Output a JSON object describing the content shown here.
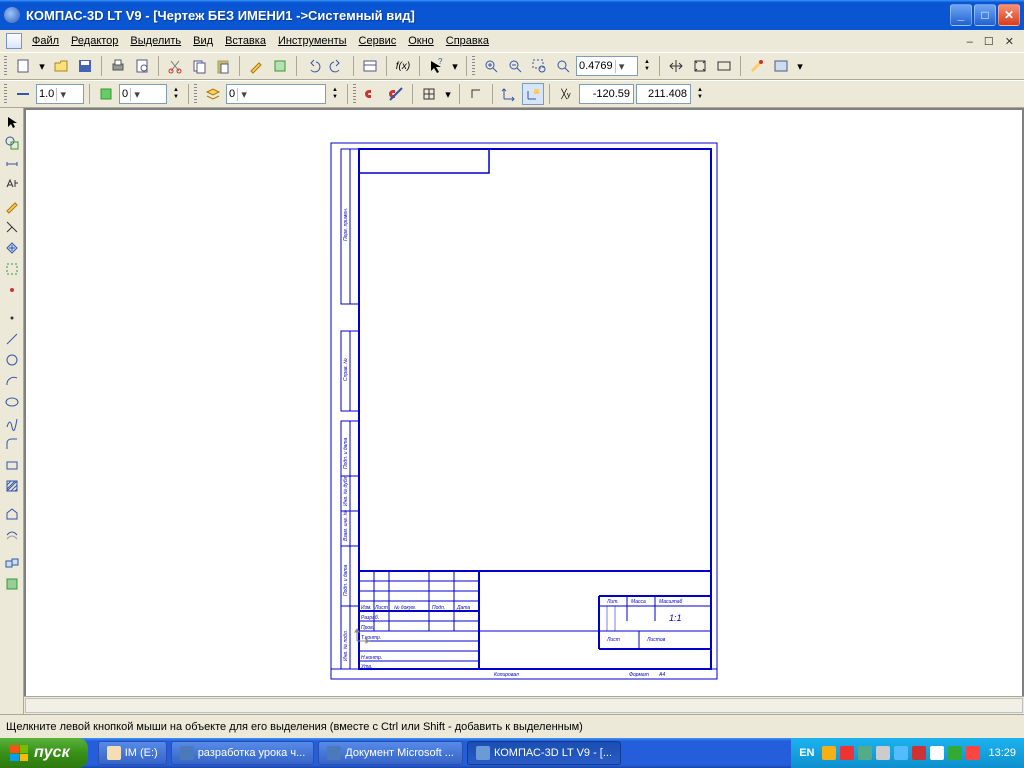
{
  "title": "КОМПАС-3D LT V9 - [Чертеж БЕЗ ИМЕНИ1 ->Системный вид]",
  "menu": {
    "file": "Файл",
    "edit": "Редактор",
    "select": "Выделить",
    "view": "Вид",
    "insert": "Вставка",
    "tools": "Инструменты",
    "service": "Сервис",
    "window": "Окно",
    "help": "Справка"
  },
  "toolbar1": {
    "zoom_value": "0.4769"
  },
  "toolbar2": {
    "style_value": "1.0",
    "layer_value": "0",
    "state_value": "0",
    "coord_x": "-120.59",
    "coord_y": "211.408"
  },
  "drawing": {
    "stamp": {
      "col_izm": "Изм.",
      "col_list": "Лист",
      "col_ndoc": "№ докум.",
      "col_podp": "Подп.",
      "col_data": "Дата",
      "row_razrab": "Разраб.",
      "row_prov": "Пров.",
      "row_tcontr": "Т.контр.",
      "row_ncontr": "Н.контр.",
      "row_utv": "Утв.",
      "lit": "Лит.",
      "massa": "Масса",
      "masshtab": "Масштаб",
      "scale": "1:1",
      "list": "Лист",
      "listov": "Листов",
      "kopirovai": "Копировал",
      "format": "Формат",
      "format_val": "А4"
    },
    "side": {
      "perv_primen": "Перв. примен.",
      "sprav_no": "Справ. №",
      "podp_data": "Подп. и дата",
      "inv_dubl": "Инв. № дубл.",
      "vzam_inv": "Взам. инв. №",
      "podp_data2": "Подп. и дата",
      "inv_podl": "Инв. № подл."
    }
  },
  "status": "Щелкните левой кнопкой мыши на объекте для его выделения (вместе с Ctrl или Shift - добавить к выделенным)",
  "taskbar": {
    "start": "пуск",
    "items": [
      {
        "label": "IM (E:)"
      },
      {
        "label": "разработка урока ч..."
      },
      {
        "label": "Документ Microsoft ..."
      },
      {
        "label": "КОМПАС-3D LT V9 - [..."
      }
    ],
    "lang": "EN",
    "clock": "13:29"
  }
}
